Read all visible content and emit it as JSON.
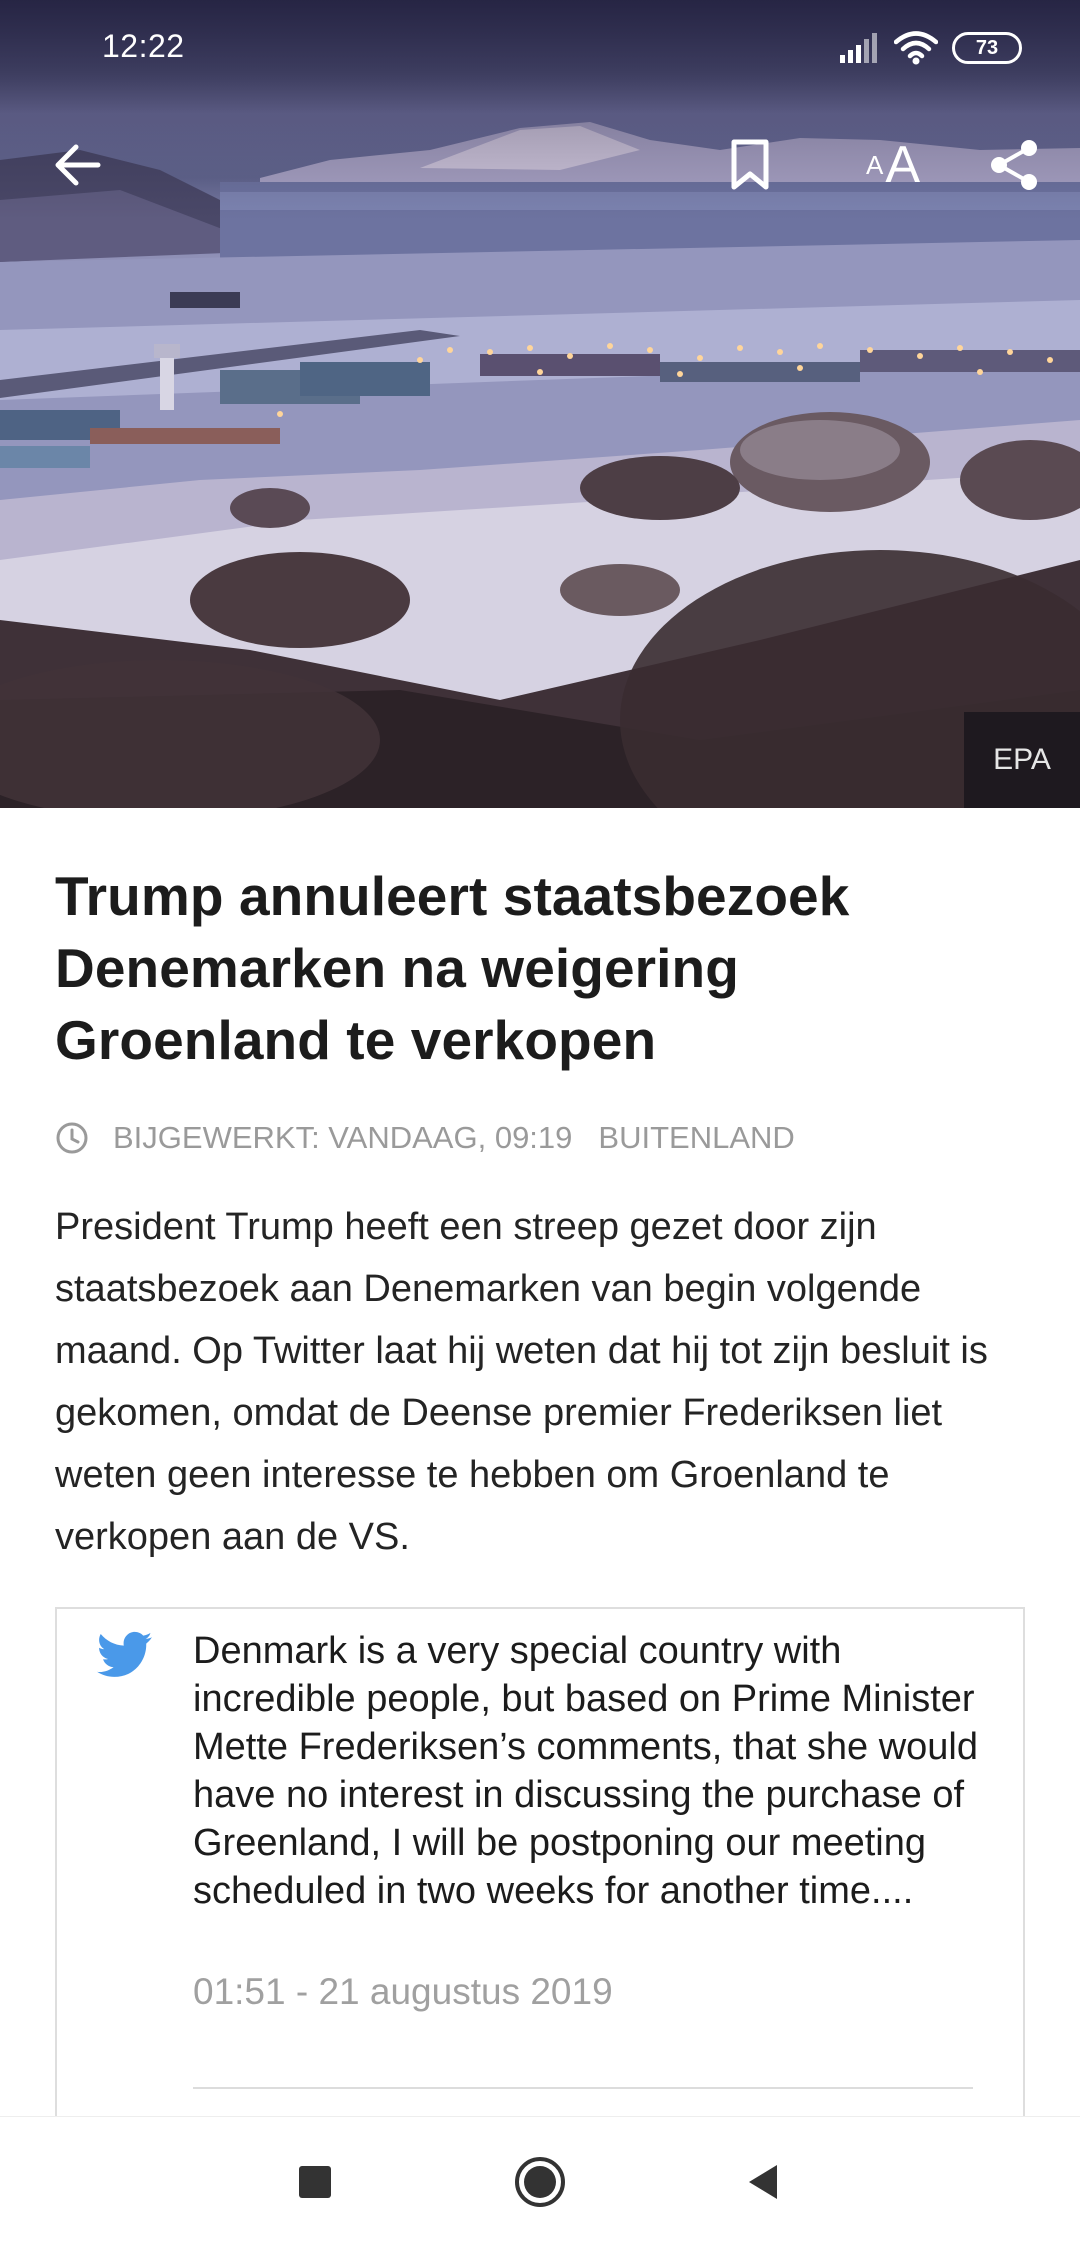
{
  "status_bar": {
    "time": "12:22",
    "battery": "73",
    "icons": [
      "signal-icon",
      "wifi-icon",
      "battery-icon"
    ]
  },
  "toolbar": {
    "back_icon": "arrow-left-icon",
    "bookmark_icon": "bookmark-icon",
    "text_size_small": "A",
    "text_size_large": "A",
    "share_icon": "share-icon"
  },
  "hero": {
    "photo_credit": "EPA"
  },
  "article": {
    "headline": "Trump annuleert staatsbezoek Denemarken na weigering Groenland te verkopen",
    "updated": "BIJGEWERKT: VANDAAG, 09:19",
    "category": "BUITENLAND",
    "lead": "President Trump heeft een streep gezet door zijn staatsbezoek aan Denemarken van begin volgende maand. Op Twitter laat hij weten dat hij tot zijn besluit is gekomen, omdat de Deense premier Frederiksen liet weten geen interesse te hebben om Groenland te verkopen aan de VS."
  },
  "tweet": {
    "text": "Denmark is a very special country with incredible people, but based on Prime Minister Mette Frederiksen’s comments, that she would have no interest in discussing the purchase of Greenland, I will be postponing our meeting scheduled in two weeks for another time....",
    "date": "01:51 - 21 augustus 2019",
    "icon": "twitter-bird-icon"
  },
  "nav_bar": {
    "icons": [
      "recent-apps-icon",
      "home-icon",
      "back-icon"
    ]
  },
  "colors": {
    "twitter_blue": "#4a99e9",
    "meta_gray": "#9a9a9a",
    "headline": "#1c1c1c"
  }
}
